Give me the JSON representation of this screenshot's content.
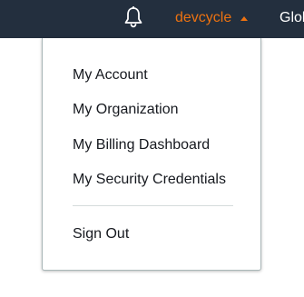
{
  "header": {
    "account_name": "devcycle",
    "region_label": "Global",
    "bell_icon": "bell-icon",
    "caret_icon": "caret-up-icon"
  },
  "account_menu": {
    "items": [
      {
        "label": "My Account"
      },
      {
        "label": "My Organization"
      },
      {
        "label": "My Billing Dashboard"
      },
      {
        "label": "My Security Credentials"
      }
    ],
    "sign_out_label": "Sign Out"
  },
  "colors": {
    "header_bg": "#232f3e",
    "accent": "#ec7211",
    "header_text": "#ffffff",
    "menu_text": "#16191f",
    "divider": "#d5dbdb"
  }
}
